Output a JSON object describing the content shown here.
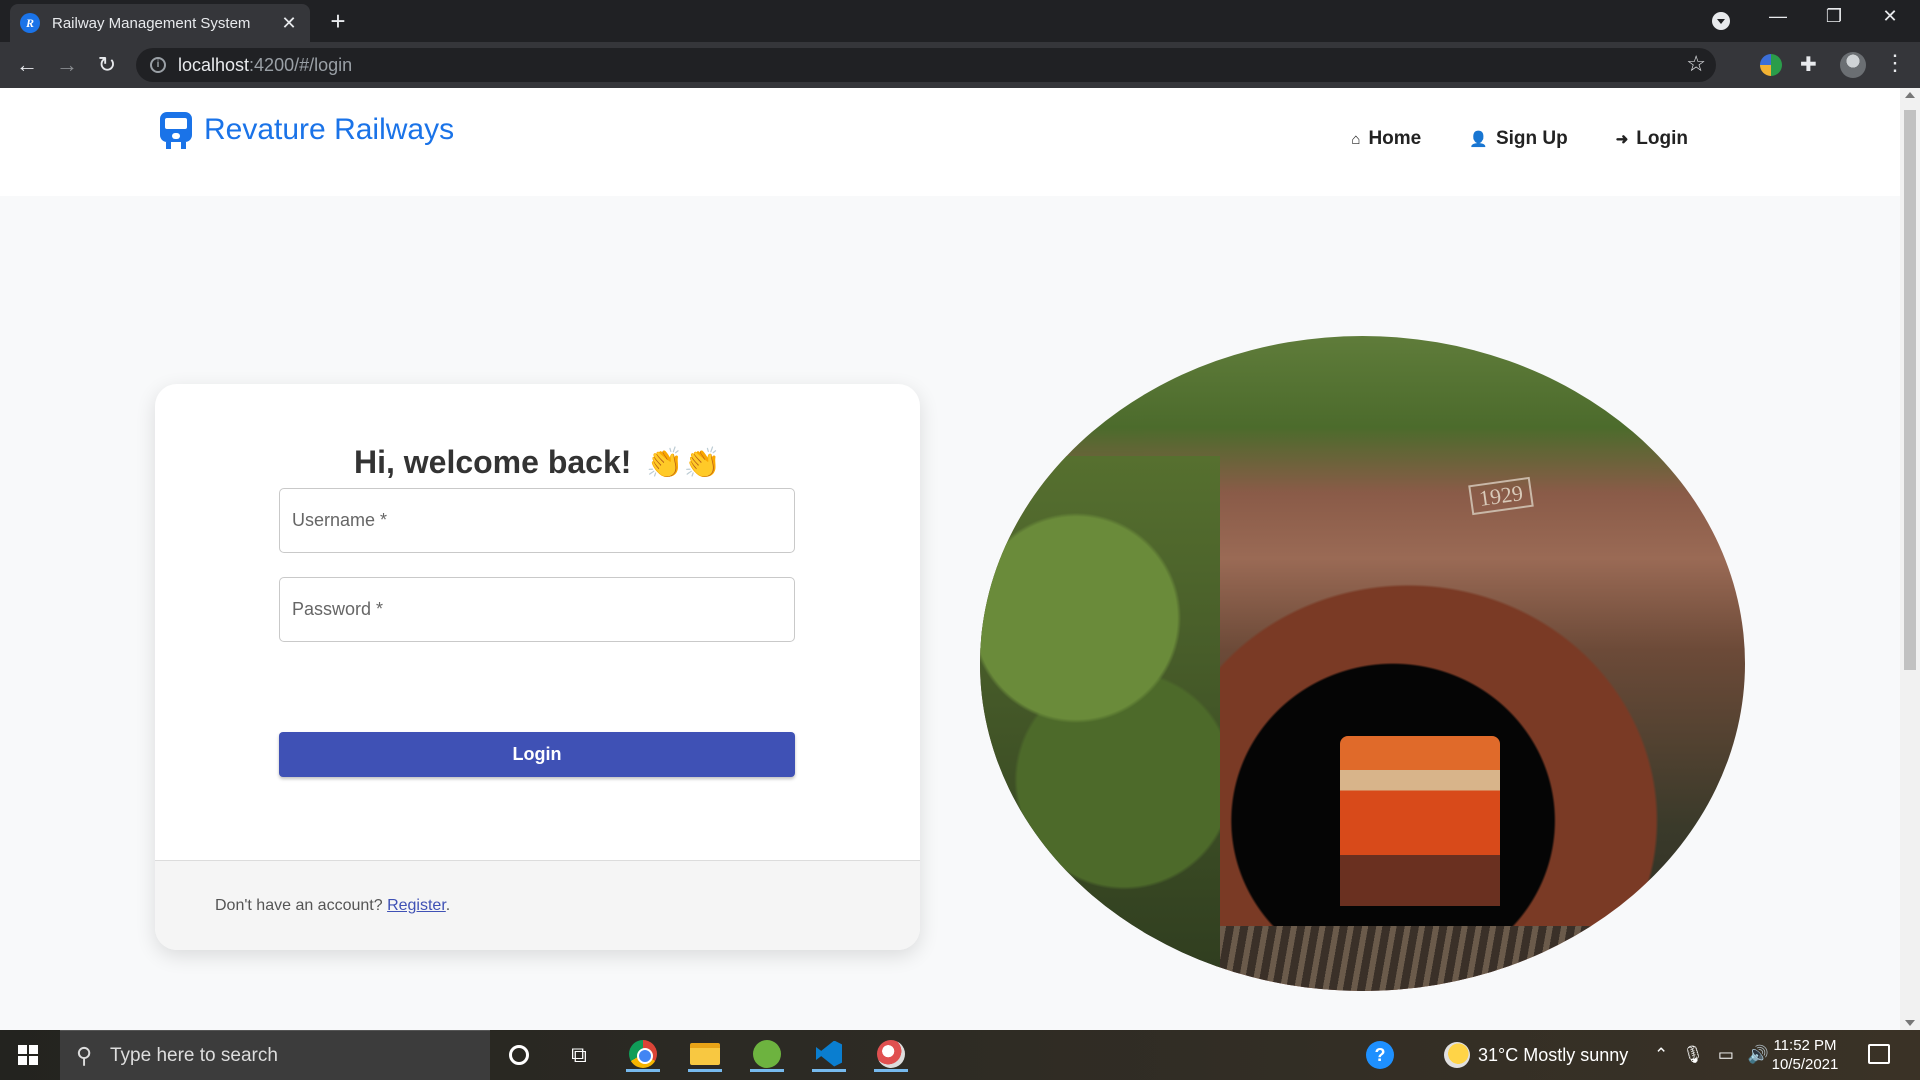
{
  "browser": {
    "tab_title": "Railway Management System",
    "tab_favicon": "R",
    "url_host": "localhost",
    "url_path": ":4200/#/login"
  },
  "page": {
    "brand": "Revature Railways",
    "nav": [
      {
        "label": "Home",
        "icon": "home-icon"
      },
      {
        "label": "Sign Up",
        "icon": "user-plus-icon"
      },
      {
        "label": "Login",
        "icon": "sign-in-icon"
      }
    ],
    "login": {
      "title": "Hi, welcome back!",
      "emoji": "👏👏",
      "username_placeholder": "Username *",
      "password_placeholder": "Password *",
      "submit_label": "Login",
      "footer_text": "Don't have an account?",
      "footer_link": "Register",
      "footer_suffix": "."
    },
    "photo": {
      "year_plate": "1929"
    }
  },
  "taskbar": {
    "search_placeholder": "Type here to search",
    "weather": "31°C  Mostly sunny",
    "time": "11:52 PM",
    "date": "10/5/2021"
  },
  "colors": {
    "brand_blue": "#1a73e8",
    "button_indigo": "#3f51b5"
  }
}
